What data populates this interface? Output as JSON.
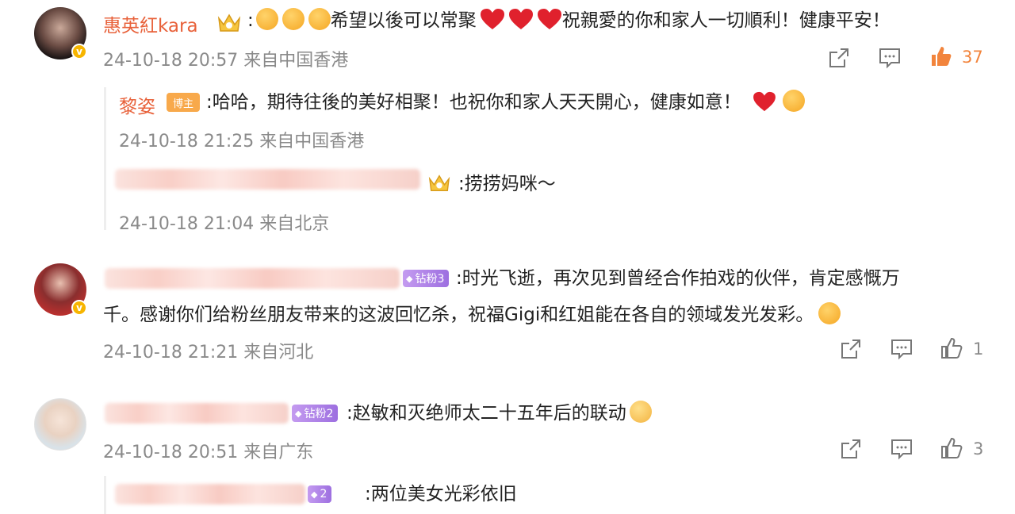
{
  "comments": [
    {
      "author": "惠英紅kara",
      "text_before_emojis": ":",
      "text_mid": "希望以後可以常聚",
      "text_end": "祝親愛的你和家人一切順利！健康平安！",
      "timestamp": "24-10-18 20:57",
      "location": "来自中国香港",
      "likes": "37",
      "liked": true,
      "replies": [
        {
          "author": "黎姿",
          "author_badge": "博主",
          "text": ":哈哈，期待往後的美好相聚！也祝你和家人天天開心，健康如意！",
          "timestamp": "24-10-18 21:25",
          "location": "来自中国香港"
        },
        {
          "text": ":捞捞妈咪～",
          "timestamp": "24-10-18 21:04",
          "location": "来自北京"
        }
      ]
    },
    {
      "level_badge": "钻粉3",
      "text_line1": ":时光飞逝，再次见到曾经合作拍戏的伙伴，肯定感慨万",
      "text_line2": "千。感谢你们给粉丝朋友带来的这波回忆杀，祝福Gigi和红姐能在各自的领域发光发彩。",
      "timestamp": "24-10-18 21:21",
      "location": "来自河北",
      "likes": "1"
    },
    {
      "level_badge": "钻粉2",
      "text": ":赵敏和灭绝师太二十五年后的联动",
      "timestamp": "24-10-18 20:51",
      "location": "来自广东",
      "likes": "3",
      "replies": [
        {
          "level_badge": "2",
          "text": ":两位美女光彩依旧"
        }
      ]
    }
  ],
  "icons": {
    "share": "share-icon",
    "comment": "comment-icon",
    "like": "thumbs-up-icon",
    "verified": "verified-badge-icon",
    "crown": "crown-badge-icon"
  },
  "colors": {
    "author_name": "#e8613a",
    "like_active": "#f2843c",
    "meta": "#8a8a8a",
    "level_badge": "#a678e8",
    "verified": "#f7b500"
  }
}
